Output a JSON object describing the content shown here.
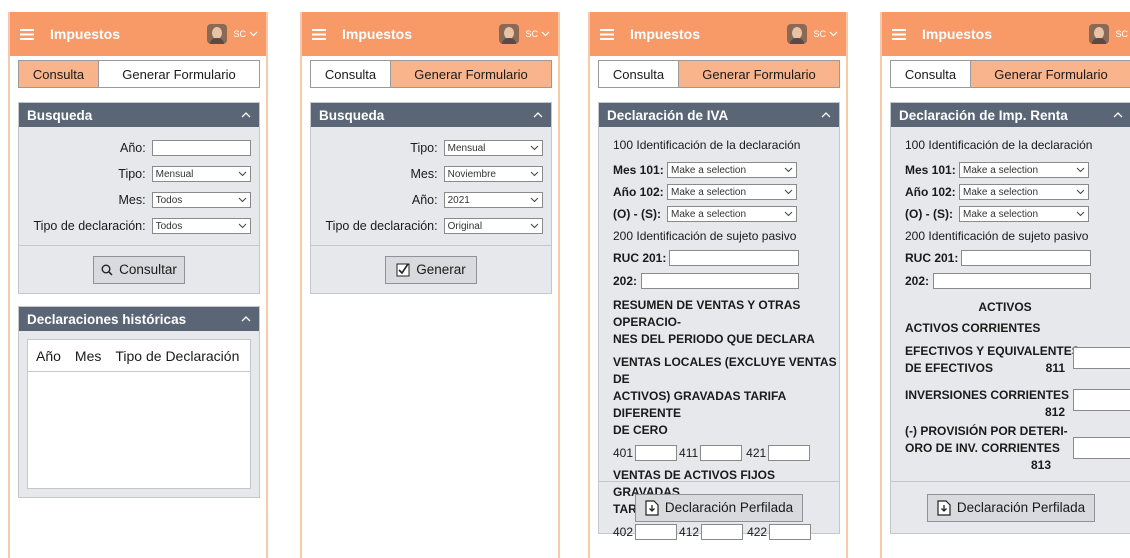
{
  "app": {
    "title": "Impuestos",
    "user": "SC"
  },
  "tabs": {
    "consulta": "Consulta",
    "generar": "Generar Formulario"
  },
  "s1": {
    "panel_title": "Busqueda",
    "labels": {
      "anio": "Año:",
      "tipo": "Tipo:",
      "mes": "Mes:",
      "tipo_decl": "Tipo de declaración:"
    },
    "values": {
      "anio": "",
      "tipo": "Mensual",
      "mes": "Todos",
      "tipo_decl": "Todos"
    },
    "button": "Consultar",
    "hist_title": "Declaraciones históricas",
    "columns": [
      "Año",
      "Mes",
      "Tipo de Declaración"
    ]
  },
  "s2": {
    "panel_title": "Busqueda",
    "labels": {
      "tipo": "Tipo:",
      "mes": "Mes:",
      "anio": "Año:",
      "tipo_decl": "Tipo de declaración:"
    },
    "values": {
      "tipo": "Mensual",
      "mes": "Noviembre",
      "anio": "2021",
      "tipo_decl": "Original"
    },
    "button": "Generar"
  },
  "s3": {
    "panel_title": "Declaración de IVA",
    "sec100": "100 Identificación de la declaración",
    "mes101": "Mes 101:",
    "anio102": "Año 102:",
    "os": "(O) - (S):",
    "placeholder": "Make a selection",
    "sec200": "200 Identificación de sujeto pasivo",
    "ruc201": "RUC 201:",
    "f202": "202:",
    "resumen_1": "RESUMEN DE VENTAS Y OTRAS OPERACIO-",
    "resumen_2": "NES DEL PERIODO QUE DECLARA",
    "ventas_loc_1": "VENTAS LOCALES (EXCLUYE VENTAS DE",
    "ventas_loc_2": "ACTIVOS) GRAVADAS TARIFA DIFERENTE",
    "ventas_loc_3": "DE CERO",
    "c401": "401",
    "c411": "411",
    "c421": "421",
    "ventas_act_1": "VENTAS DE ACTIVOS FIJOS GRAVADAS",
    "ventas_act_2": "TARIFA DIFERENTE DE CERO",
    "c402": "402",
    "c412": "412",
    "c422": "422",
    "button": "Declaración Perfilada"
  },
  "s4": {
    "panel_title": "Declaración de Imp. Renta",
    "sec100": "100 Identificación de la declaración",
    "mes101": "Mes 101:",
    "anio102": "Año 102:",
    "os": "(O) - (S):",
    "placeholder": "Make a selection",
    "sec200": "200 Identificación de sujeto pasivo",
    "ruc201": "RUC 201:",
    "f202": "202:",
    "activos": "ACTIVOS",
    "activos_corr": "ACTIVOS CORRIENTES",
    "efectivos_1": "EFECTIVOS Y EQUIVALENTES",
    "efectivos_2": "DE EFECTIVOS",
    "c811": "811",
    "inversiones": "INVERSIONES CORRIENTES",
    "c812": "812",
    "provision_1": "(-) PROVISIÓN POR DETERI-",
    "provision_2": "ORO DE INV. CORRIENTES",
    "c813": "813",
    "button": "Declaración Perfilada"
  }
}
